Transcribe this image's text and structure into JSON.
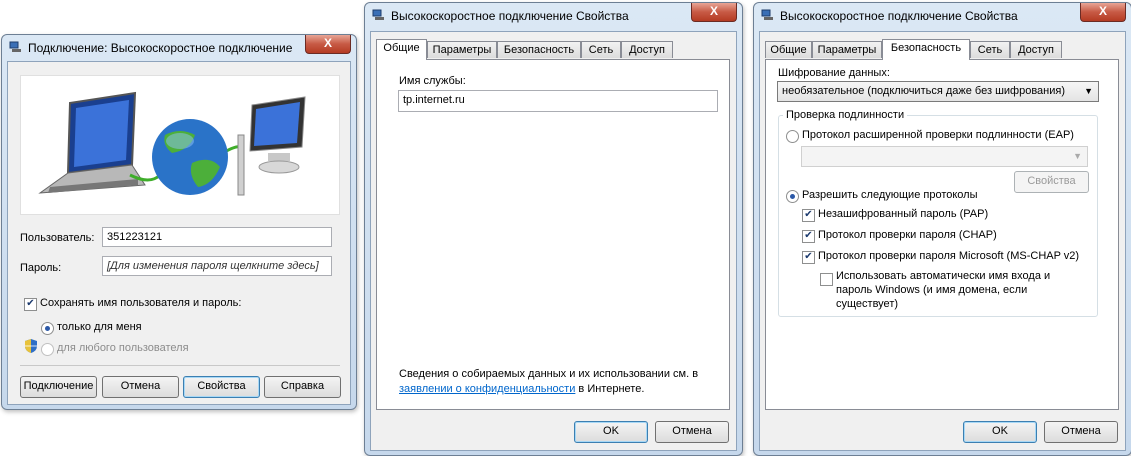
{
  "window1": {
    "title": "Подключение: Высокоскоростное подключение",
    "close": "X",
    "user_label": "Пользователь:",
    "user_value": "351223121",
    "password_label": "Пароль:",
    "password_value": "[Для изменения пароля щелкните здесь]",
    "save_label": "Сохранять имя пользователя и пароль:",
    "only_me": "только для меня",
    "any_user": "для любого пользователя",
    "btn_connect": "Подключение",
    "btn_cancel": "Отмена",
    "btn_props": "Свойства",
    "btn_help": "Справка"
  },
  "window2": {
    "title": "Высокоскоростное подключение Свойства",
    "close": "X",
    "tabs": [
      "Общие",
      "Параметры",
      "Безопасность",
      "Сеть",
      "Доступ"
    ],
    "service_label": "Имя службы:",
    "service_value": "tp.internet.ru",
    "info_text": "Сведения о собираемых данных и их использовании см. в",
    "info_link": "заявлении о конфиденциальности",
    "info_tail": " в Интернете.",
    "btn_ok": "OK",
    "btn_cancel": "Отмена"
  },
  "window3": {
    "title": "Высокоскоростное подключение Свойства",
    "close": "X",
    "tabs": [
      "Общие",
      "Параметры",
      "Безопасность",
      "Сеть",
      "Доступ"
    ],
    "encryption_label": "Шифрование данных:",
    "encryption_value": "необязательное (подключиться даже без шифрования)",
    "auth_group": "Проверка подлинности",
    "eap_label": "Протокол расширенной проверки подлинности (EAP)",
    "eap_props": "Свойства",
    "allow_label": "Разрешить следующие протоколы",
    "pap": "Незашифрованный пароль (PAP)",
    "chap": "Протокол проверки пароля (CHAP)",
    "mschap": "Протокол проверки пароля Microsoft (MS-CHAP v2)",
    "auto_line1": "Использовать автоматически имя входа и",
    "auto_line2": "пароль Windows (и имя домена, если",
    "auto_line3": "существует)",
    "btn_ok": "OK",
    "btn_cancel": "Отмена"
  },
  "colors": {
    "title_bg": "#c6d8ec",
    "close": "#c75a45",
    "link": "#0066cc",
    "default_button": "#3c7fb1"
  }
}
